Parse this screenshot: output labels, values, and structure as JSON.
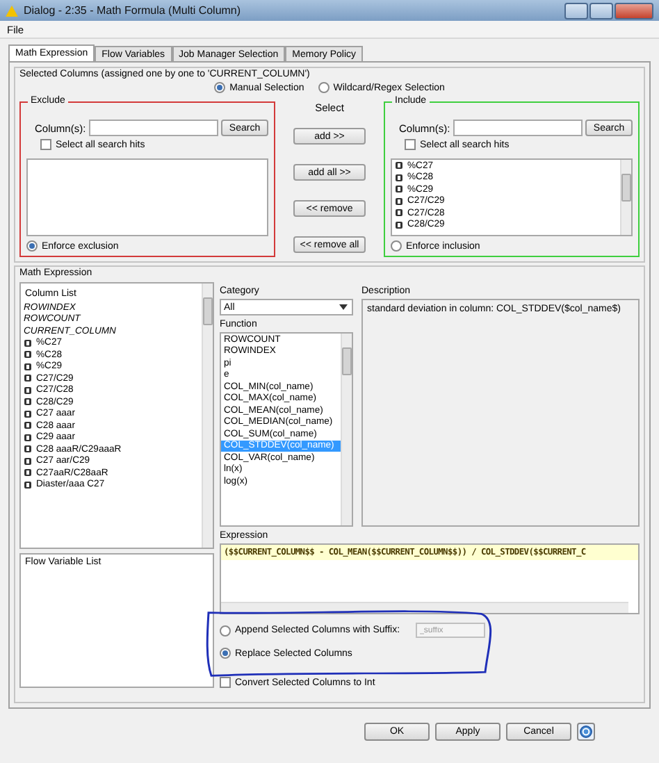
{
  "window": {
    "title": "Dialog - 2:35 - Math Formula (Multi Column)"
  },
  "menu": [
    "File"
  ],
  "tabs": [
    {
      "label": "Math Expression",
      "selected": true
    },
    {
      "label": "Flow Variables",
      "selected": false
    },
    {
      "label": "Job Manager Selection",
      "selected": false
    },
    {
      "label": "Memory Policy",
      "selected": false
    }
  ],
  "column_selection": {
    "title": "Selected Columns (assigned one by one to 'CURRENT_COLUMN')",
    "modes": [
      {
        "label": "Manual Selection",
        "selected": true
      },
      {
        "label": "Wildcard/Regex Selection",
        "selected": false
      }
    ],
    "exclude": {
      "title": "Exclude",
      "search_label": "Column(s):",
      "search_button": "Search",
      "select_all": {
        "label": "Select all search hits",
        "checked": false
      },
      "enforce": {
        "label": "Enforce exclusion",
        "selected": true
      }
    },
    "select": {
      "title": "Select",
      "buttons": [
        "add >>",
        "add all >>",
        "<< remove",
        "<< remove all"
      ]
    },
    "include": {
      "title": "Include",
      "search_label": "Column(s):",
      "search_button": "Search",
      "select_all": {
        "label": "Select all search hits",
        "checked": false
      },
      "items": [
        "%C27",
        "%C28",
        "%C29",
        "C27/C29",
        "C27/C28",
        "C28/C29"
      ],
      "enforce": {
        "label": "Enforce inclusion",
        "selected": false
      }
    }
  },
  "math_expression": {
    "title": "Math Expression",
    "column_list": {
      "title": "Column List",
      "items": [
        {
          "label": "ROWINDEX",
          "kind": "special"
        },
        {
          "label": "ROWCOUNT",
          "kind": "special"
        },
        {
          "label": "CURRENT_COLUMN",
          "kind": "special"
        },
        {
          "label": "%C27",
          "kind": "double"
        },
        {
          "label": "%C28",
          "kind": "double"
        },
        {
          "label": "%C29",
          "kind": "double"
        },
        {
          "label": "C27/C29",
          "kind": "double"
        },
        {
          "label": "C27/C28",
          "kind": "double"
        },
        {
          "label": "C28/C29",
          "kind": "double"
        },
        {
          "label": "C27 aaar",
          "kind": "double"
        },
        {
          "label": "C28 aaar",
          "kind": "double"
        },
        {
          "label": "C29 aaar",
          "kind": "double"
        },
        {
          "label": "C28 aaaR/C29aaaR",
          "kind": "double"
        },
        {
          "label": "C27 aar/C29",
          "kind": "double"
        },
        {
          "label": "C27aaR/C28aaR",
          "kind": "double"
        },
        {
          "label": "Diaster/aaa C27",
          "kind": "double"
        }
      ]
    },
    "flow_variable_list": {
      "title": "Flow Variable List"
    },
    "category": {
      "label": "Category",
      "value": "All"
    },
    "function": {
      "label": "Function",
      "items": [
        {
          "label": "ROWCOUNT",
          "selected": false
        },
        {
          "label": "ROWINDEX",
          "selected": false
        },
        {
          "label": "pi",
          "selected": false
        },
        {
          "label": "e",
          "selected": false
        },
        {
          "label": "COL_MIN(col_name)",
          "selected": false
        },
        {
          "label": "COL_MAX(col_name)",
          "selected": false
        },
        {
          "label": "COL_MEAN(col_name)",
          "selected": false
        },
        {
          "label": "COL_MEDIAN(col_name)",
          "selected": false
        },
        {
          "label": "COL_SUM(col_name)",
          "selected": false
        },
        {
          "label": "COL_STDDEV(col_name)",
          "selected": true
        },
        {
          "label": "COL_VAR(col_name)",
          "selected": false
        },
        {
          "label": "ln(x)",
          "selected": false
        },
        {
          "label": "log(x)",
          "selected": false
        }
      ]
    },
    "description": {
      "label": "Description",
      "text": "standard deviation in column: COL_STDDEV($col_name$)"
    },
    "expression": {
      "label": "Expression",
      "text": "($$CURRENT_COLUMN$$ - COL_MEAN($$CURRENT_COLUMN$$)) / COL_STDDEV($$CURRENT_C"
    }
  },
  "output": {
    "options": [
      {
        "label": "Append Selected Columns with Suffix:",
        "selected": false
      },
      {
        "label": "Replace Selected Columns",
        "selected": true
      }
    ],
    "suffix_placeholder": "_suffix",
    "convert": {
      "label": "Convert Selected Columns to Int",
      "checked": false
    }
  },
  "buttons": [
    "OK",
    "Apply",
    "Cancel"
  ]
}
